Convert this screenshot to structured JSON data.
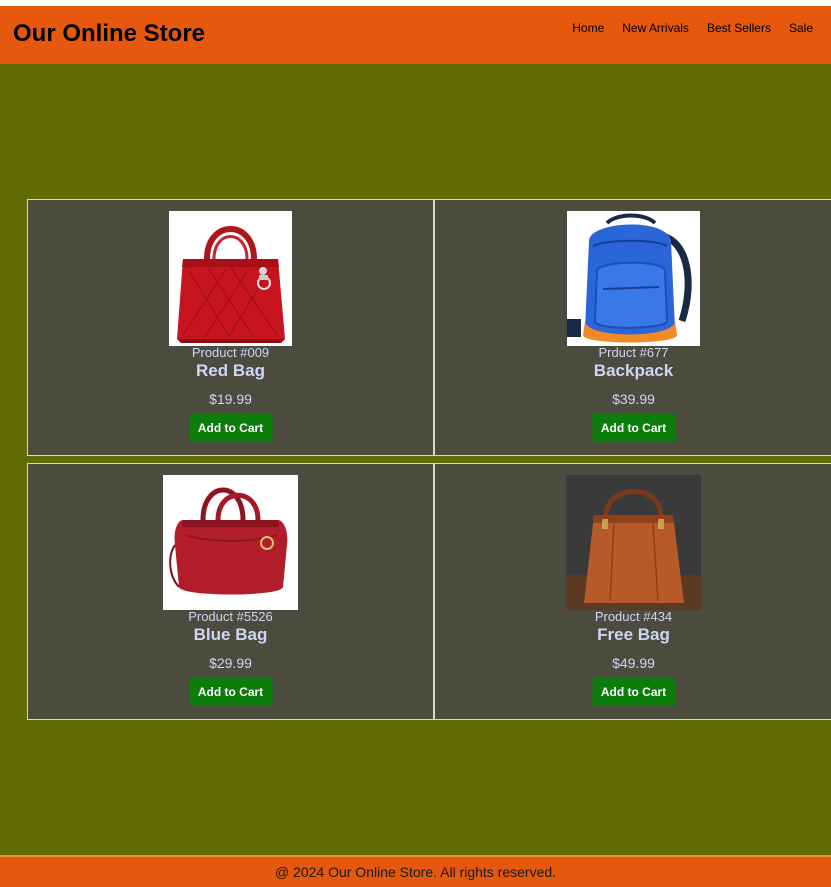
{
  "header": {
    "title": "Our Online Store",
    "nav": [
      "Home",
      "New Arrivals",
      "Best Sellers",
      "Sale"
    ]
  },
  "products": [
    {
      "id_label": "Product #009",
      "name": "Red Bag",
      "price": "$19.99",
      "button": "Add to Cart",
      "image": "red-quilted-handbag-image"
    },
    {
      "id_label": "Prduct #677",
      "name": "Backpack",
      "price": "$39.99",
      "button": "Add to Cart",
      "image": "blue-backpack-image"
    },
    {
      "id_label": "Product #5526",
      "name": "Blue Bag",
      "price": "$29.99",
      "button": "Add to Cart",
      "image": "red-doctor-bag-image"
    },
    {
      "id_label": "Product #434",
      "name": "Free Bag",
      "price": "$49.99",
      "button": "Add to Cart",
      "image": "brown-leather-tote-image"
    }
  ],
  "footer": {
    "text": "@ 2024 Our Online Store. All rights reserved."
  },
  "colors": {
    "header_bg": "#e5580e",
    "main_bg": "#626c06",
    "card_bg": "#4b4b3e",
    "button_bg": "#0a7d0a",
    "product_text": "#cfd6f5"
  }
}
